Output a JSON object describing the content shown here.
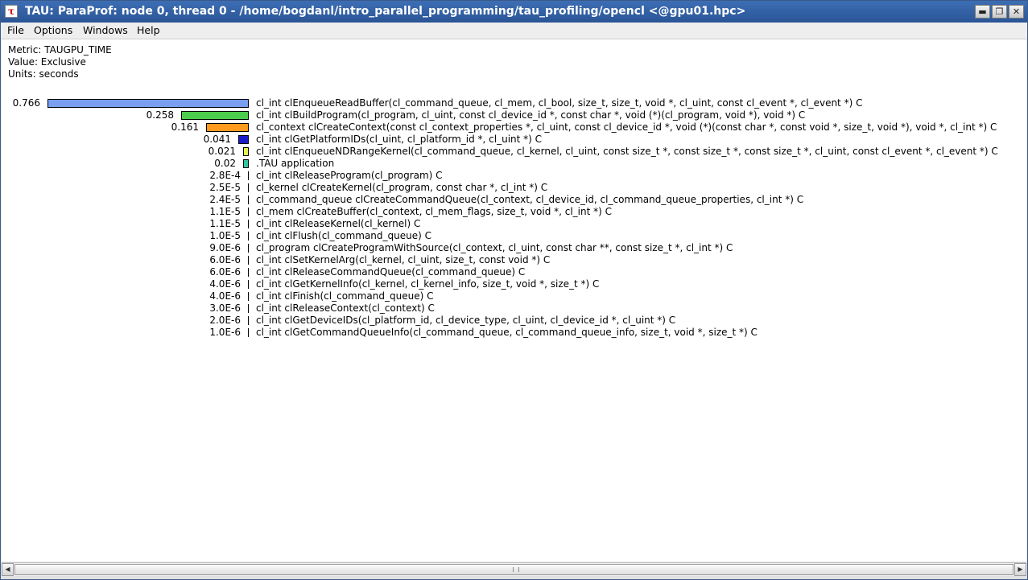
{
  "window": {
    "title": "TAU: ParaProf: node 0, thread 0 - /home/bogdanl/intro_parallel_programming/tau_profiling/opencl <@gpu01.hpc>",
    "app_icon": "τ"
  },
  "menu": {
    "file": "File",
    "options": "Options",
    "windows": "Windows",
    "help": "Help"
  },
  "header": {
    "metric": "Metric: TAUGPU_TIME",
    "value": "Value: Exclusive",
    "units": "Units: seconds"
  },
  "chart_data": {
    "type": "bar",
    "orientation": "horizontal",
    "rows": [
      {
        "value": 0.766,
        "label": "0.766",
        "name": "cl_int clEnqueueReadBuffer(cl_command_queue, cl_mem, cl_bool, size_t, size_t, void *, cl_uint, const cl_event *, cl_event *) C",
        "color": "#7a9ef0"
      },
      {
        "value": 0.258,
        "label": "0.258",
        "name": "cl_int clBuildProgram(cl_program, cl_uint, const cl_device_id *, const char *, void (*)(cl_program, void *), void *) C",
        "color": "#4ccc4c"
      },
      {
        "value": 0.161,
        "label": "0.161",
        "name": "cl_context clCreateContext(const cl_context_properties *, cl_uint, const cl_device_id *, void (*)(const char *, const void *, size_t, void *), void *, cl_int *) C",
        "color": "#ff9a1e"
      },
      {
        "value": 0.041,
        "label": "0.041",
        "name": "cl_int clGetPlatformIDs(cl_uint, cl_platform_id *, cl_uint *) C",
        "color": "#1a1acc"
      },
      {
        "value": 0.021,
        "label": "0.021",
        "name": "cl_int clEnqueueNDRangeKernel(cl_command_queue, cl_kernel, cl_uint, const size_t *, const size_t *, const size_t *, cl_uint, const cl_event *, cl_event *) C",
        "color": "#e6f050"
      },
      {
        "value": 0.02,
        "label": "0.02",
        "name": ".TAU application",
        "color": "#30c4a0"
      },
      {
        "value": 0.00028,
        "label": "2.8E-4",
        "name": "cl_int clReleaseProgram(cl_program) C",
        "color": "#000000"
      },
      {
        "value": 2.5e-05,
        "label": "2.5E-5",
        "name": "cl_kernel clCreateKernel(cl_program, const char *, cl_int *) C",
        "color": "#000000"
      },
      {
        "value": 2.4e-05,
        "label": "2.4E-5",
        "name": "cl_command_queue clCreateCommandQueue(cl_context, cl_device_id, cl_command_queue_properties, cl_int *) C",
        "color": "#000000"
      },
      {
        "value": 1.1e-05,
        "label": "1.1E-5",
        "name": "cl_mem clCreateBuffer(cl_context, cl_mem_flags, size_t, void *, cl_int *) C",
        "color": "#000000"
      },
      {
        "value": 1.1e-05,
        "label": "1.1E-5",
        "name": "cl_int clReleaseKernel(cl_kernel) C",
        "color": "#000000"
      },
      {
        "value": 1e-05,
        "label": "1.0E-5",
        "name": "cl_int clFlush(cl_command_queue) C",
        "color": "#000000"
      },
      {
        "value": 9e-06,
        "label": "9.0E-6",
        "name": "cl_program clCreateProgramWithSource(cl_context, cl_uint, const char **, const size_t *, cl_int *) C",
        "color": "#000000"
      },
      {
        "value": 6e-06,
        "label": "6.0E-6",
        "name": "cl_int clSetKernelArg(cl_kernel, cl_uint, size_t, const void *) C",
        "color": "#000000"
      },
      {
        "value": 6e-06,
        "label": "6.0E-6",
        "name": "cl_int clReleaseCommandQueue(cl_command_queue) C",
        "color": "#000000"
      },
      {
        "value": 4e-06,
        "label": "4.0E-6",
        "name": "cl_int clGetKernelInfo(cl_kernel, cl_kernel_info, size_t, void *, size_t *) C",
        "color": "#000000"
      },
      {
        "value": 4e-06,
        "label": "4.0E-6",
        "name": "cl_int clFinish(cl_command_queue) C",
        "color": "#000000"
      },
      {
        "value": 3e-06,
        "label": "3.0E-6",
        "name": "cl_int clReleaseContext(cl_context) C",
        "color": "#000000"
      },
      {
        "value": 2e-06,
        "label": "2.0E-6",
        "name": "cl_int clGetDeviceIDs(cl_platform_id, cl_device_type, cl_uint, cl_device_id *, cl_uint *) C",
        "color": "#000000"
      },
      {
        "value": 1e-06,
        "label": "1.0E-6",
        "name": "cl_int clGetCommandQueueInfo(cl_command_queue, cl_command_queue_info, size_t, void *, size_t *) C",
        "color": "#000000"
      }
    ]
  }
}
